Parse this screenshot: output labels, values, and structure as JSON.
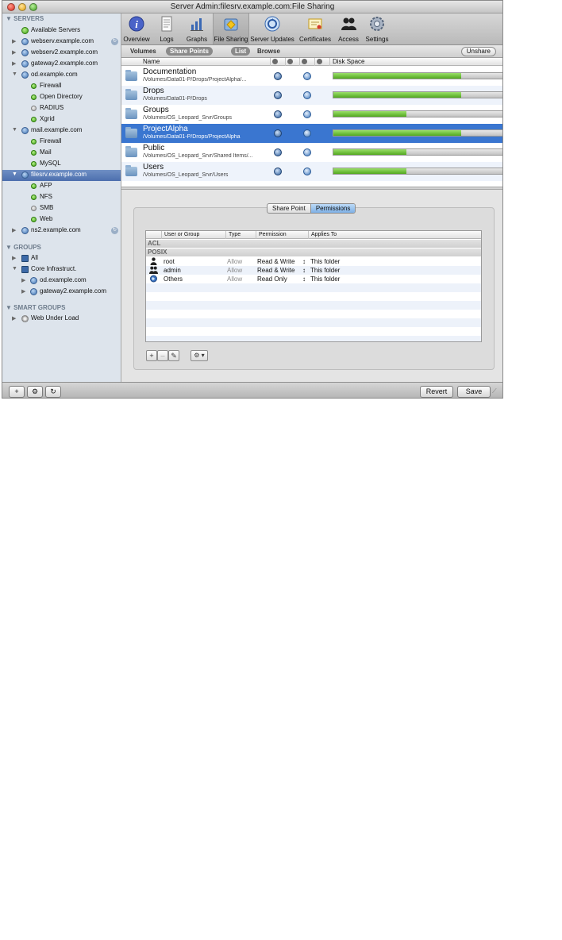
{
  "window": {
    "title": "Server Admin:filesrv.example.com:File Sharing"
  },
  "sidebar": {
    "sections": {
      "servers": "SERVERS",
      "groups": "GROUPS",
      "smart_groups": "SMART GROUPS"
    },
    "items": [
      {
        "label": "Available Servers"
      },
      {
        "label": "webserv.example.com"
      },
      {
        "label": "webserv2.example.com"
      },
      {
        "label": "gateway2.example.com"
      },
      {
        "label": "od.example.com"
      },
      {
        "label": "Firewall"
      },
      {
        "label": "Open Directory"
      },
      {
        "label": "RADIUS"
      },
      {
        "label": "Xgrid"
      },
      {
        "label": "mail.example.com"
      },
      {
        "label": "Firewall"
      },
      {
        "label": "Mail"
      },
      {
        "label": "MySQL"
      },
      {
        "label": "filesrv.example.com"
      },
      {
        "label": "AFP"
      },
      {
        "label": "NFS"
      },
      {
        "label": "SMB"
      },
      {
        "label": "Web"
      },
      {
        "label": "ns2.example.com"
      },
      {
        "label": "All"
      },
      {
        "label": "Core Infrastruct."
      },
      {
        "label": "od.example.com"
      },
      {
        "label": "gateway2.example.com"
      },
      {
        "label": "Web Under Load"
      }
    ]
  },
  "toolbar": {
    "items": [
      {
        "label": "Overview",
        "icon": "info-icon"
      },
      {
        "label": "Logs",
        "icon": "logs-icon"
      },
      {
        "label": "Graphs",
        "icon": "graphs-icon"
      },
      {
        "label": "File Sharing",
        "icon": "file-sharing-icon"
      },
      {
        "label": "Server Updates",
        "icon": "server-updates-icon"
      },
      {
        "label": "Certificates",
        "icon": "certificates-icon"
      },
      {
        "label": "Access",
        "icon": "access-icon"
      },
      {
        "label": "Settings",
        "icon": "settings-icon"
      }
    ]
  },
  "subbar": {
    "volumes": "Volumes",
    "share_points": "Share Points",
    "list": "List",
    "browse": "Browse",
    "unshare": "Unshare"
  },
  "sharepoints": {
    "headers": {
      "name": "Name",
      "disk_space": "Disk Space"
    },
    "rows": [
      {
        "name": "Documentation",
        "path": "/Volumes/Data01-P/Drops/ProjectAlpha/...",
        "disk_used": 0.74
      },
      {
        "name": "Drops",
        "path": "/Volumes/Data01-P/Drops",
        "disk_used": 0.74
      },
      {
        "name": "Groups",
        "path": "/Volumes/OS_Leopard_Srvr/Groups",
        "disk_used": 0.42
      },
      {
        "name": "ProjectAlpha",
        "path": "/Volumes/Data01-P/Drops/ProjectAlpha",
        "disk_used": 0.74
      },
      {
        "name": "Public",
        "path": "/Volumes/OS_Leopard_Srvr/Shared Items/...",
        "disk_used": 0.42
      },
      {
        "name": "Users",
        "path": "/Volumes/OS_Leopard_Srvr/Users",
        "disk_used": 0.42
      }
    ]
  },
  "detail": {
    "tabs": [
      "Share Point",
      "Permissions"
    ],
    "columns": [
      "User or Group",
      "Type",
      "Permission",
      "Applies To"
    ],
    "sections": {
      "acl": "ACL",
      "posix": "POSIX"
    },
    "entries": [
      {
        "name": "root",
        "type": "Allow",
        "permission": "Read & Write",
        "applies_to": "This folder",
        "stepper": "↕"
      },
      {
        "name": "admin",
        "type": "Allow",
        "permission": "Read & Write",
        "applies_to": "This folder",
        "stepper": "↕"
      },
      {
        "name": "Others",
        "type": "Allow",
        "permission": "Read Only",
        "applies_to": "This folder",
        "stepper": "↕"
      }
    ],
    "buttons": {
      "add": "+",
      "remove": "–",
      "edit": "✎",
      "action": "⚙ ▾"
    }
  },
  "bottombar": {
    "add": "+",
    "action": "⚙",
    "refresh": "↻",
    "revert": "Revert",
    "save": "Save"
  },
  "colors": {
    "selection": "#3a76d0",
    "sidebar_selection": "#4c6fae",
    "disk_fill": "#52a81f",
    "sidebar_bg": "#dde4ec"
  }
}
